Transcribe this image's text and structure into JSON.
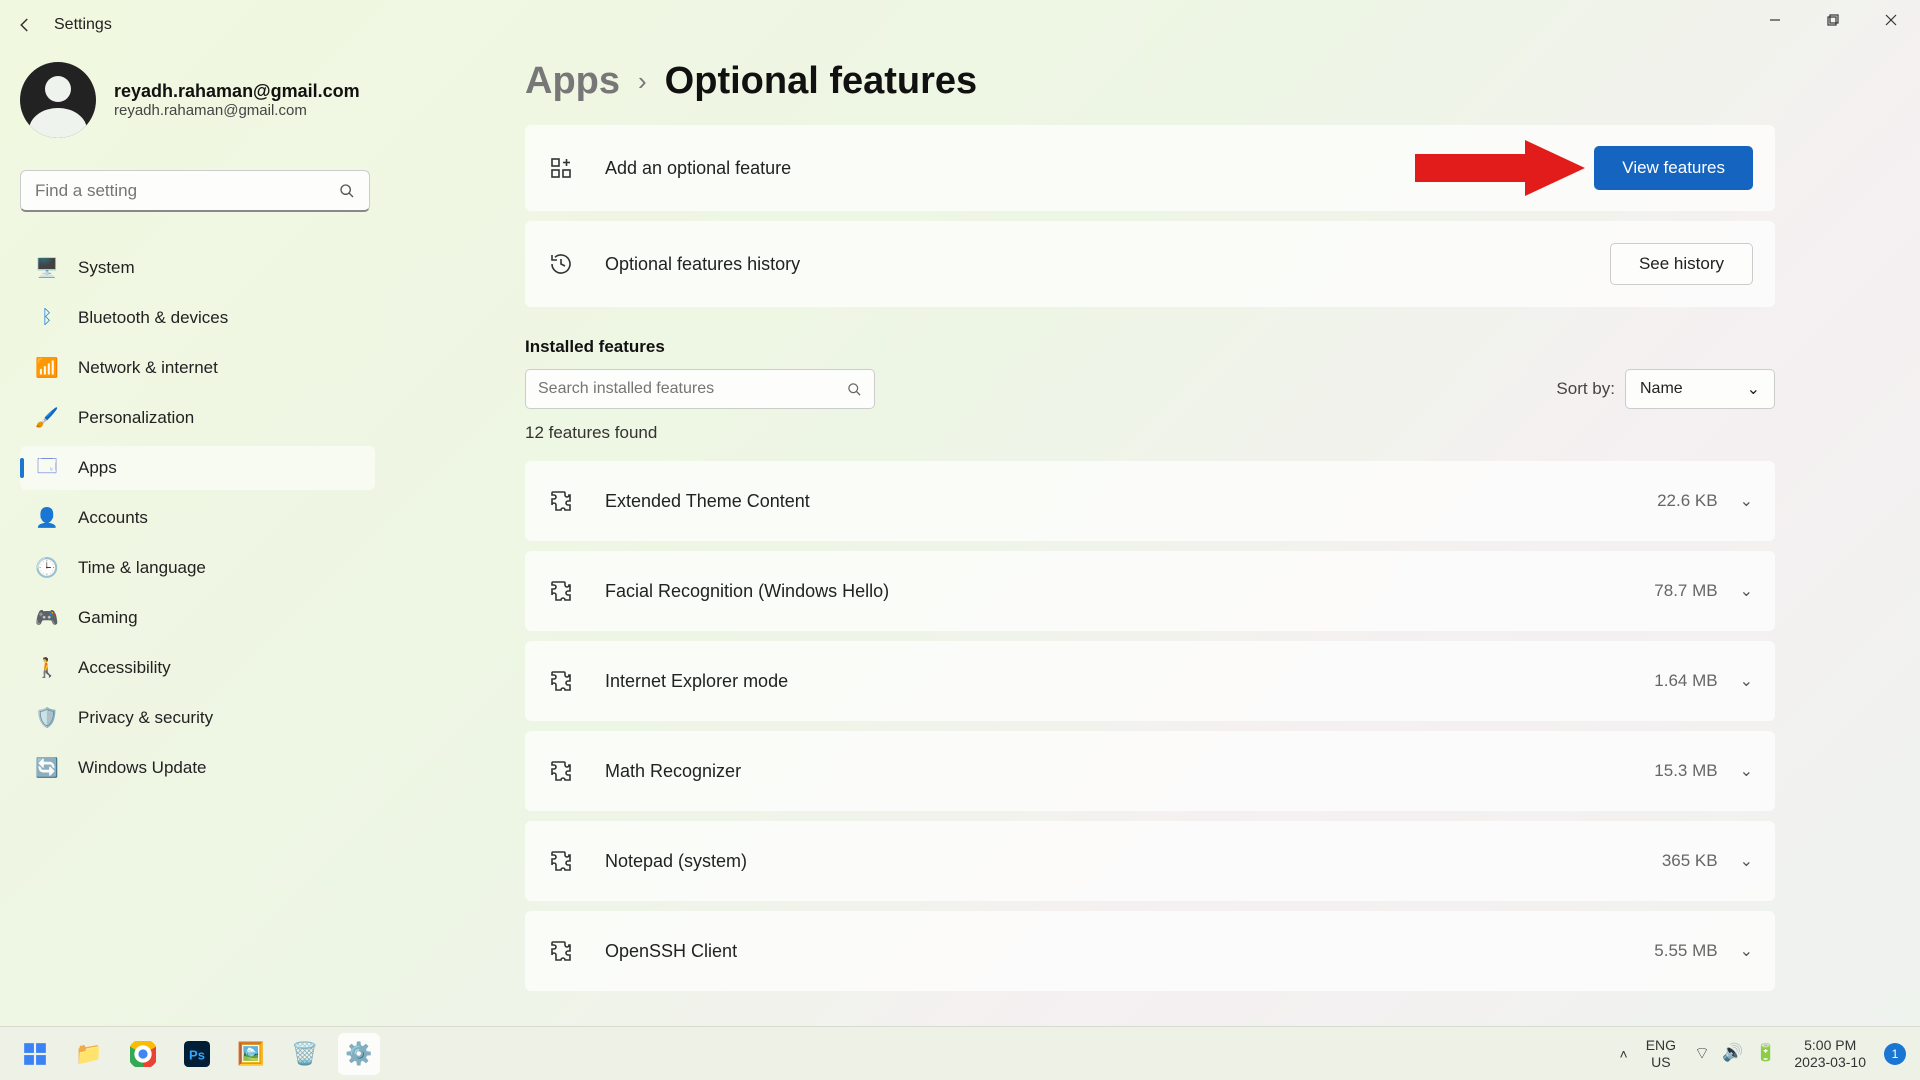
{
  "window_title": "Settings",
  "profile": {
    "name": "reyadh.rahaman@gmail.com",
    "email": "reyadh.rahaman@gmail.com"
  },
  "search_placeholder": "Find a setting",
  "nav": [
    {
      "label": "System",
      "icon": "🖥️"
    },
    {
      "label": "Bluetooth & devices",
      "icon": "ᛒ"
    },
    {
      "label": "Network & internet",
      "icon": "📶"
    },
    {
      "label": "Personalization",
      "icon": "🖌️"
    },
    {
      "label": "Apps",
      "icon": "🗔",
      "selected": true
    },
    {
      "label": "Accounts",
      "icon": "👤"
    },
    {
      "label": "Time & language",
      "icon": "🕒"
    },
    {
      "label": "Gaming",
      "icon": "🎮"
    },
    {
      "label": "Accessibility",
      "icon": "🚶"
    },
    {
      "label": "Privacy & security",
      "icon": "🛡️"
    },
    {
      "label": "Windows Update",
      "icon": "🔄"
    }
  ],
  "breadcrumb": {
    "parent": "Apps",
    "current": "Optional features"
  },
  "add_card": {
    "label": "Add an optional feature",
    "button": "View features"
  },
  "history_card": {
    "label": "Optional features history",
    "button": "See history"
  },
  "installed": {
    "title": "Installed features",
    "search_placeholder": "Search installed features",
    "sort_label": "Sort by:",
    "sort_value": "Name",
    "count_text": "12 features found"
  },
  "features": [
    {
      "name": "Extended Theme Content",
      "size": "22.6 KB"
    },
    {
      "name": "Facial Recognition (Windows Hello)",
      "size": "78.7 MB"
    },
    {
      "name": "Internet Explorer mode",
      "size": "1.64 MB"
    },
    {
      "name": "Math Recognizer",
      "size": "15.3 MB"
    },
    {
      "name": "Notepad (system)",
      "size": "365 KB"
    },
    {
      "name": "OpenSSH Client",
      "size": "5.55 MB"
    }
  ],
  "taskbar": {
    "lang1": "ENG",
    "lang2": "US",
    "time": "5:00 PM",
    "date": "2023-03-10",
    "notif_count": "1"
  }
}
